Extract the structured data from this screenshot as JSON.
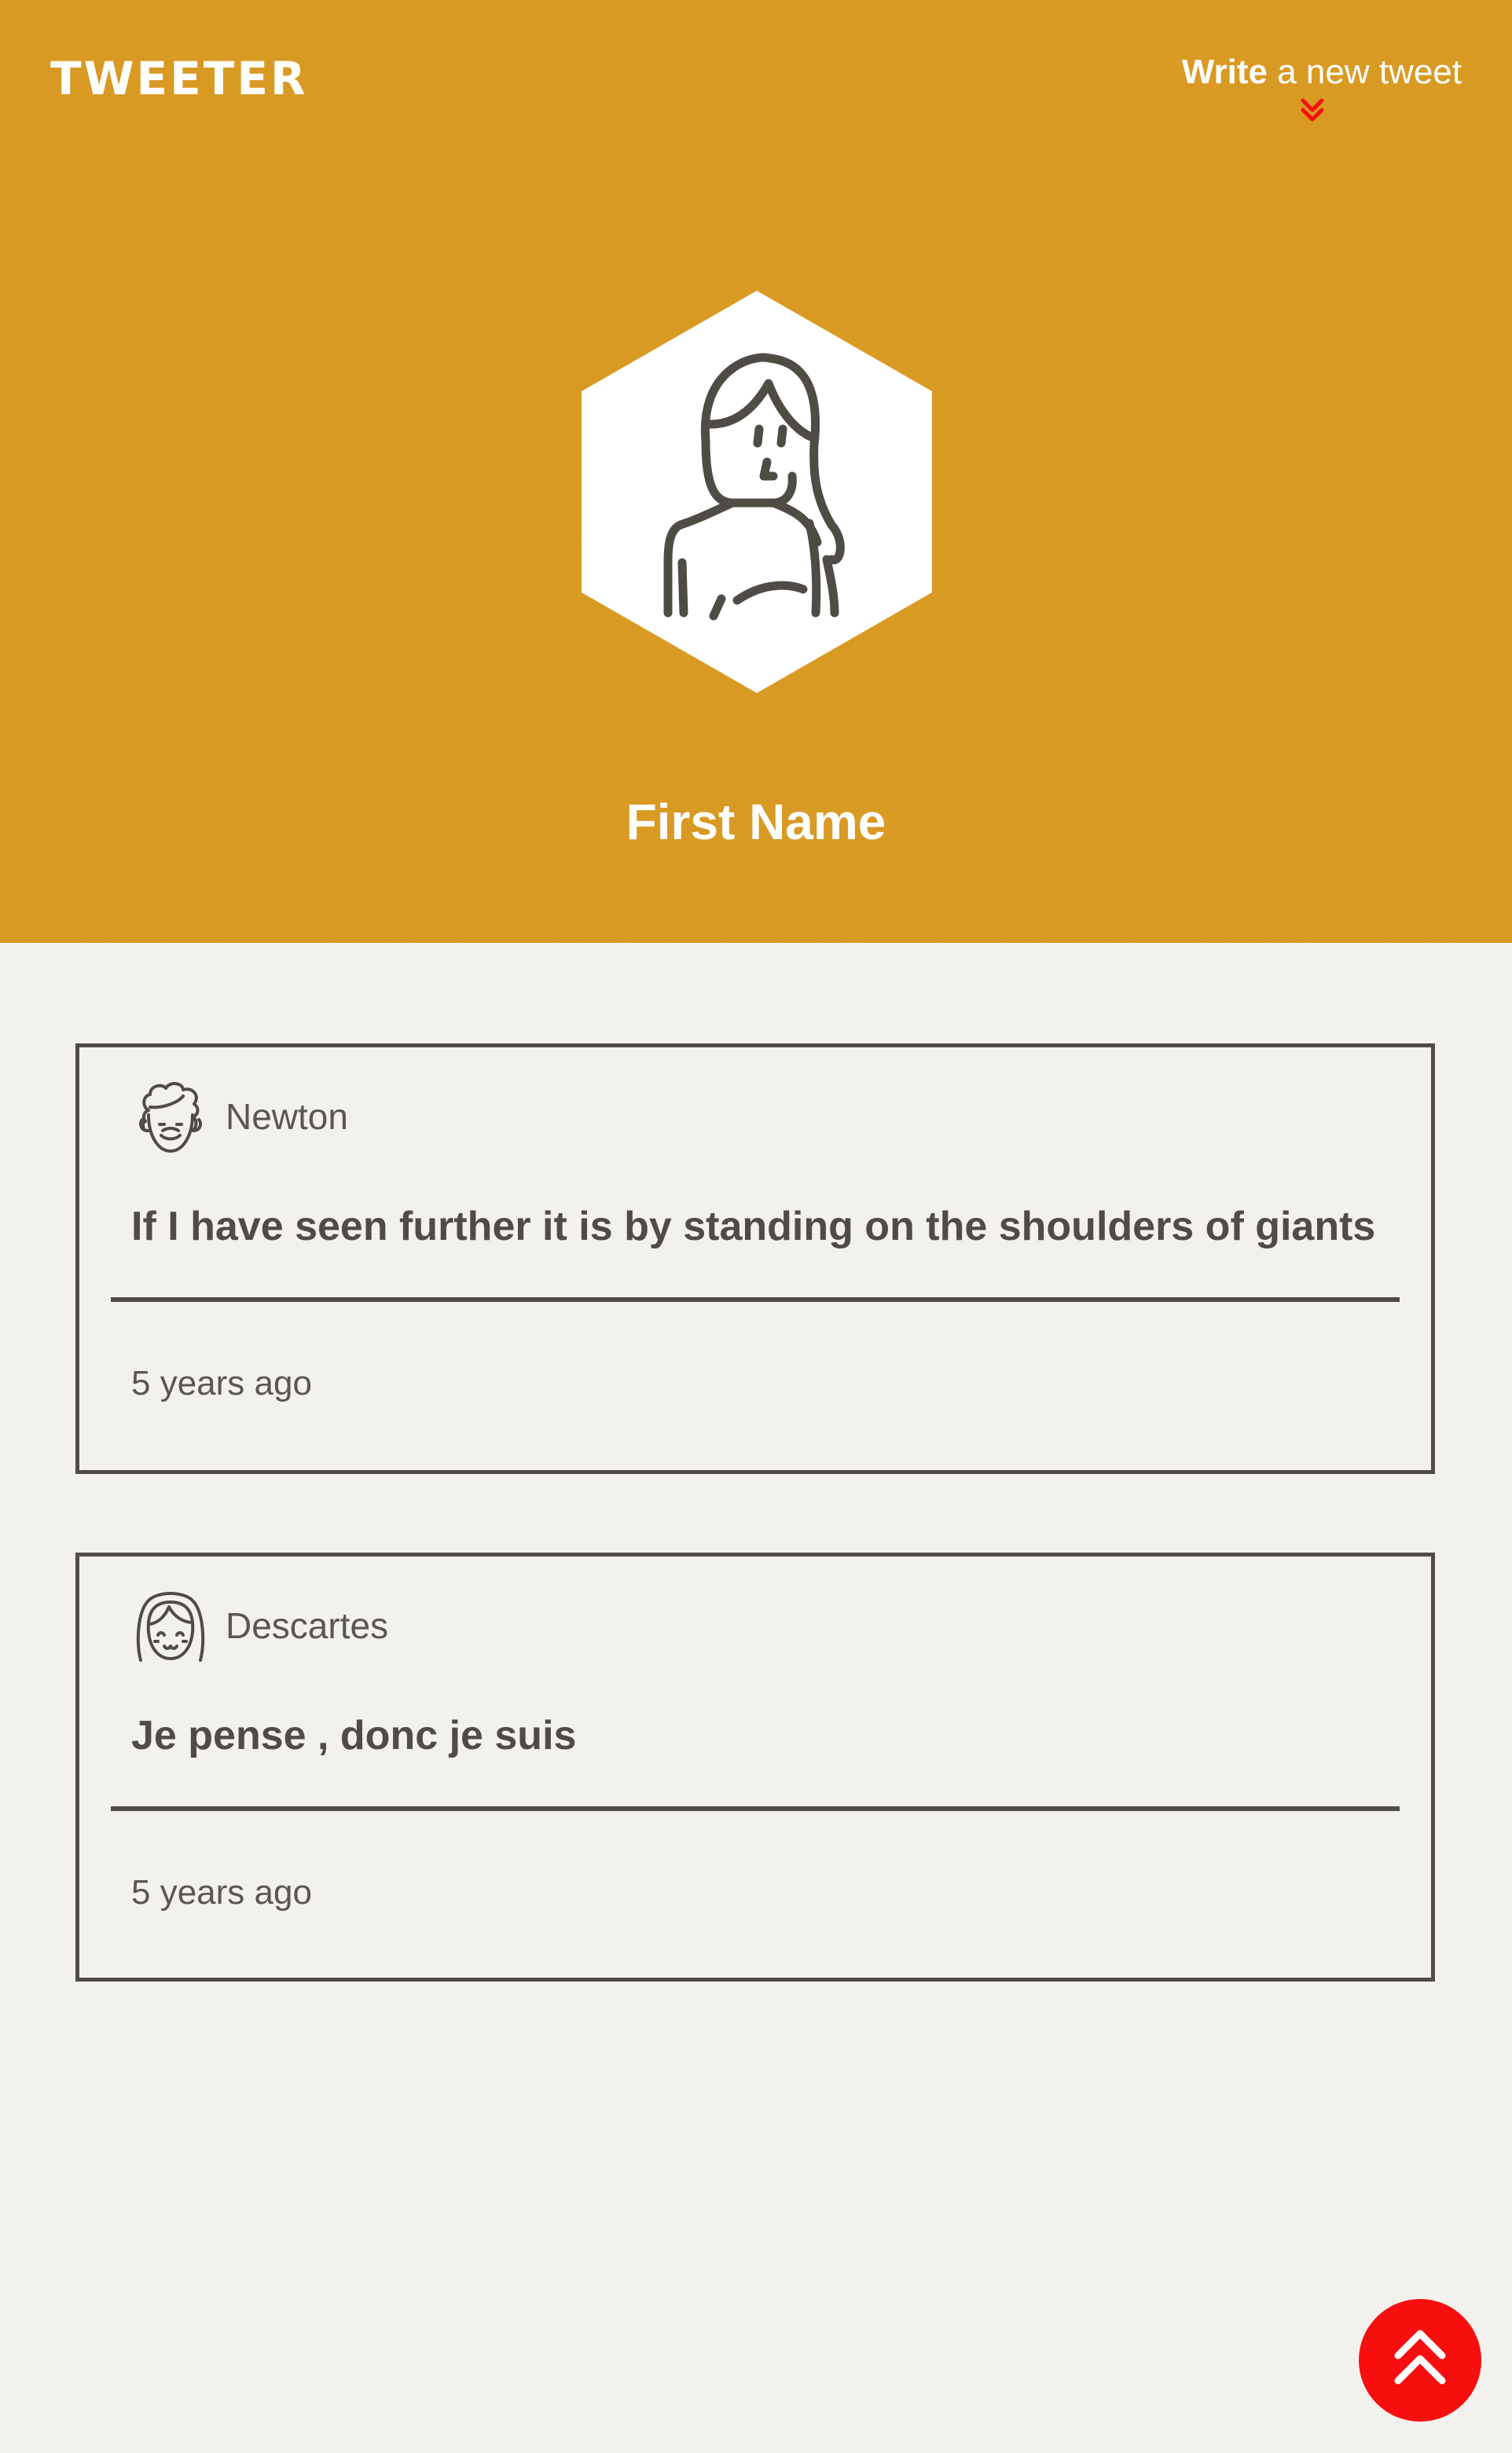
{
  "header": {
    "logo": "TWEETER",
    "write_bold": "Write",
    "write_rest": " a new tweet",
    "arrow_icon": "double-chevron-down-icon",
    "background": "#d99a23",
    "accent": "#f70f0f"
  },
  "profile": {
    "name": "First Name",
    "avatar_icon": "woman-avatar-icon"
  },
  "tweets": [
    {
      "author": "Newton",
      "avatar_icon": "curly-hair-man-avatar-icon",
      "text": "If I have seen further it is by standing on the shoulders of giants",
      "time": "5 years ago"
    },
    {
      "author": "Descartes",
      "avatar_icon": "bob-hair-avatar-icon",
      "text": "Je pense , donc je suis",
      "time": "5 years ago"
    }
  ],
  "scroll_top": {
    "icon": "double-chevron-up-icon",
    "color": "#f70f0f"
  }
}
